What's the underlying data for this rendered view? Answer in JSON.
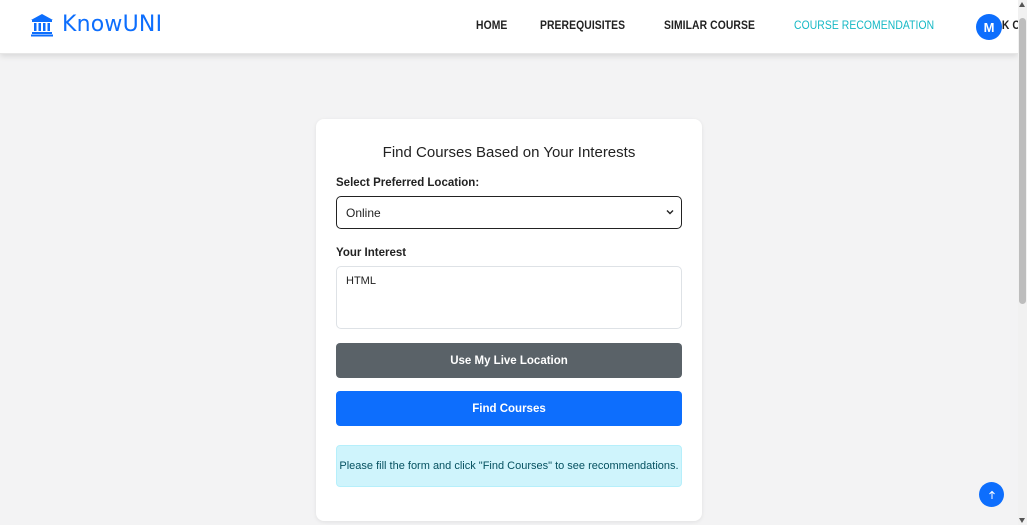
{
  "brand": {
    "name": "KnowUNI",
    "icon": "university-icon"
  },
  "nav": {
    "items": [
      {
        "label": "HOME",
        "active": false
      },
      {
        "label": "PREREQUISITES",
        "active": false
      },
      {
        "label": "SIMILAR COURSE",
        "active": false
      },
      {
        "label": "COURSE RECOMENDATION",
        "active": true
      },
      {
        "label": "BOOK COURSE",
        "active": false
      }
    ],
    "avatar_initial": "M"
  },
  "form": {
    "title": "Find Courses Based on Your Interests",
    "location_label": "Select Preferred Location:",
    "location_value": "Online",
    "interest_label": "Your Interest",
    "interest_value": "HTML",
    "live_location_button": "Use My Live Location",
    "find_button": "Find Courses",
    "info_message": "Please fill the form and click \"Find Courses\" to see recommendations."
  },
  "colors": {
    "primary": "#0d6efd",
    "active_nav": "#14b8c4",
    "secondary_button": "#5a6268",
    "info_bg": "#cff4fc",
    "page_bg": "#f3f3f4"
  }
}
